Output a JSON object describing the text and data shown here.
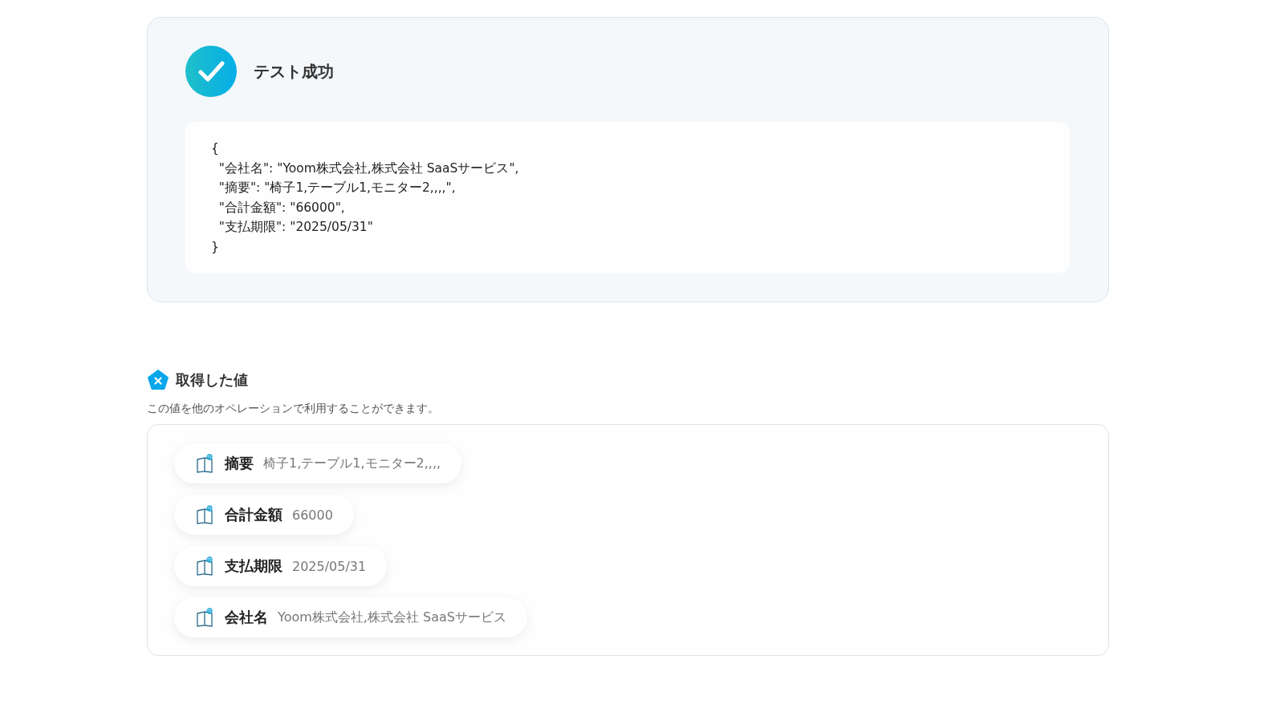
{
  "result": {
    "title": "テスト成功",
    "code_lines": [
      "{",
      "  \"会社名\": \"Yoom株式会社,株式会社 SaaSサービス\",",
      "  \"摘要\": \"椅子1,テーブル1,モニター2,,,,\",",
      "  \"合計金額\": \"66000\",",
      "  \"支払期限\": \"2025/05/31\"",
      "}"
    ]
  },
  "values": {
    "title": "取得した値",
    "description": "この値を他のオペレーションで利用することができます。",
    "items": [
      {
        "label": "摘要",
        "value": "椅子1,テーブル1,モニター2,,,,"
      },
      {
        "label": "合計金額",
        "value": "66000"
      },
      {
        "label": "支払期限",
        "value": "2025/05/31"
      },
      {
        "label": "会社名",
        "value": "Yoom株式会社,株式会社 SaaSサービス"
      }
    ]
  }
}
